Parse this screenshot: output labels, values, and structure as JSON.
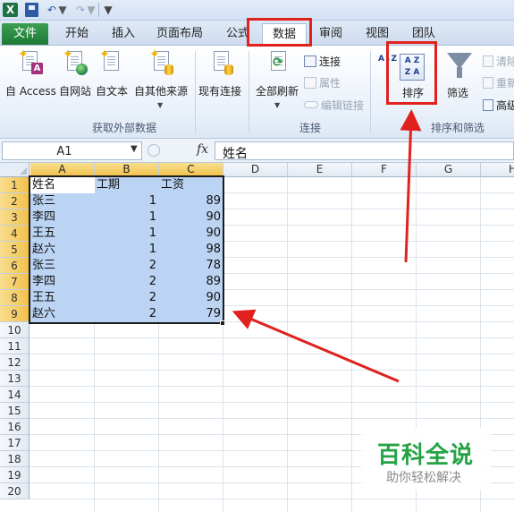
{
  "quick_access": {
    "app_icon": "excel-icon",
    "save_icon": "save-icon",
    "undo_icon": "undo-icon",
    "redo_icon": "redo-icon",
    "customize_icon": "customize-qat-icon"
  },
  "tabs": [
    {
      "label": "文件"
    },
    {
      "label": "开始"
    },
    {
      "label": "插入"
    },
    {
      "label": "页面布局"
    },
    {
      "label": "公式"
    },
    {
      "label": "数据"
    },
    {
      "label": "审阅"
    },
    {
      "label": "视图"
    },
    {
      "label": "团队"
    }
  ],
  "ribbon": {
    "get_external": {
      "access": "自 Access",
      "web": "自网站",
      "text": "自文本",
      "other": "自其他来源",
      "group_label": "获取外部数据"
    },
    "existing": "现有连接",
    "connections": {
      "refresh_all": "全部刷新",
      "connections": "连接",
      "properties": "属性",
      "edit_links": "编辑链接",
      "group_label": "连接"
    },
    "sort_filter": {
      "sort_az": "A↓Z",
      "sort_btn_icon": "A Z\nZ A",
      "sort": "排序",
      "filter": "筛选",
      "clear": "清除",
      "reapply": "重新",
      "advanced": "高级",
      "group_label": "排序和筛选"
    }
  },
  "formula_bar": {
    "name_box": "A1",
    "fx": "fx",
    "formula": "姓名"
  },
  "grid": {
    "columns": [
      "A",
      "B",
      "C",
      "D",
      "E",
      "F",
      "G",
      "H"
    ],
    "rows": [
      "1",
      "2",
      "3",
      "4",
      "5",
      "6",
      "7",
      "8",
      "9",
      "10",
      "11",
      "12",
      "13",
      "14",
      "15",
      "16",
      "17",
      "18",
      "19",
      "20"
    ],
    "headers": [
      "姓名",
      "工期",
      "工资"
    ],
    "data": [
      [
        "张三",
        "1",
        "89"
      ],
      [
        "李四",
        "1",
        "90"
      ],
      [
        "王五",
        "1",
        "90"
      ],
      [
        "赵六",
        "1",
        "98"
      ],
      [
        "张三",
        "2",
        "78"
      ],
      [
        "李四",
        "2",
        "89"
      ],
      [
        "王五",
        "2",
        "90"
      ],
      [
        "赵六",
        "2",
        "79"
      ]
    ]
  },
  "watermark": {
    "title": "百科全说",
    "subtitle": "助你轻松解决"
  },
  "colors": {
    "highlight": "#e0211d",
    "selection": "#bcd4f3",
    "file_tab": "#2a8a3f",
    "watermark": "#25a244"
  }
}
